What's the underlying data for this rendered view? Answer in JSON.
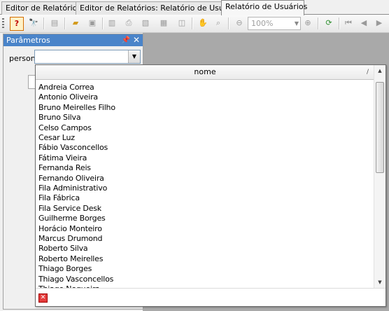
{
  "tabs": [
    {
      "label": "Editor de Relatórios"
    },
    {
      "label": "Editor de Relatórios: Relatório de Usuários"
    },
    {
      "label": "Relatório de Usuários"
    }
  ],
  "toolbar": {
    "zoom_value": "100%",
    "icons": [
      "help-icon",
      "binoculars-icon",
      "open-icon",
      "save-icon",
      "page-setup-icon",
      "print-icon",
      "export-icon",
      "pages-icon",
      "layout-icon",
      "hand-icon",
      "zoom-tool-icon",
      "zoom-out-icon",
      "zoom-in-icon",
      "refresh-icon",
      "first-page-icon",
      "prev-page-icon",
      "next-page-icon"
    ]
  },
  "params_panel": {
    "title": "Parâmetros",
    "person_label": "person",
    "person_value": ""
  },
  "dropdown": {
    "column_header": "nome",
    "sort_indicator": "/",
    "items": [
      "Andreia Correa",
      "Antonio Oliveira",
      "Bruno Meirelles Filho",
      "Bruno Silva",
      "Celso Campos",
      "Cesar Luz",
      "Fábio Vasconcellos",
      "Fátima Vieira",
      "Fernanda Reis",
      "Fernando Oliveira",
      "Fila Administrativo",
      "Fila Fábrica",
      "Fila Service Desk",
      "Guilherme Borges",
      "Horácio Monteiro",
      "Marcus Drumond",
      "Roberto Silva",
      "Roberto Meirelles",
      "Thiago Borges",
      "Thiago Vasconcellos",
      "Thiago Nogueira"
    ]
  }
}
